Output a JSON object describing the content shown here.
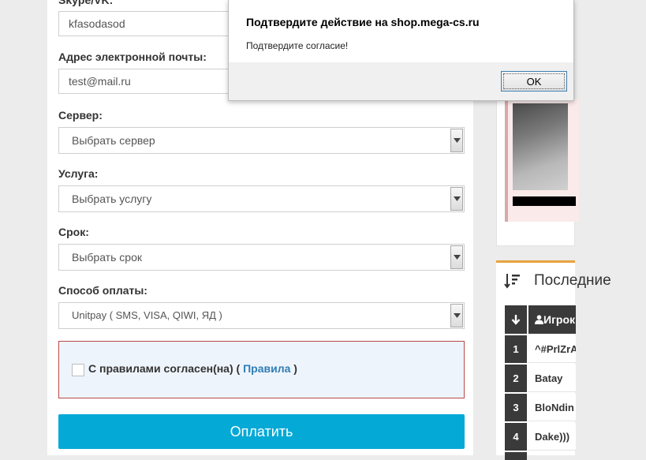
{
  "form": {
    "skype_label": "Skype/VK:",
    "skype_value": "kfasodasod",
    "email_label": "Адрес электронной почты:",
    "email_value": "test@mail.ru",
    "server_label": "Сервер:",
    "server_value": "Выбрать сервер",
    "service_label": "Услуга:",
    "service_value": "Выбрать услугу",
    "term_label": "Срок:",
    "term_value": "Выбрать срок",
    "payment_label": "Способ оплаты:",
    "payment_value": "Unitpay ( SMS, VISA, QIWI, ЯД )",
    "agree_text": "С правилами согласен(на) (",
    "agree_link": "Правила",
    "agree_close": ")",
    "pay_button": "Оплатить"
  },
  "dialog": {
    "title": "Подтвердите действие на shop.mega-cs.ru",
    "message": "Подтвердите согласие!",
    "ok_label": "OK"
  },
  "sidebar": {
    "recent_title": "Последние",
    "table_header_player": "Игрок",
    "rows": [
      {
        "num": "1",
        "name": "^#PrlZrA"
      },
      {
        "num": "2",
        "name": "Batay"
      },
      {
        "num": "3",
        "name": "BloNdin"
      },
      {
        "num": "4",
        "name": "Dake)))"
      }
    ]
  },
  "colors": {
    "accent": "#05a9d6",
    "error_border": "#b94a48",
    "link": "#2f7db6",
    "widget_top": "#e8a33d"
  }
}
